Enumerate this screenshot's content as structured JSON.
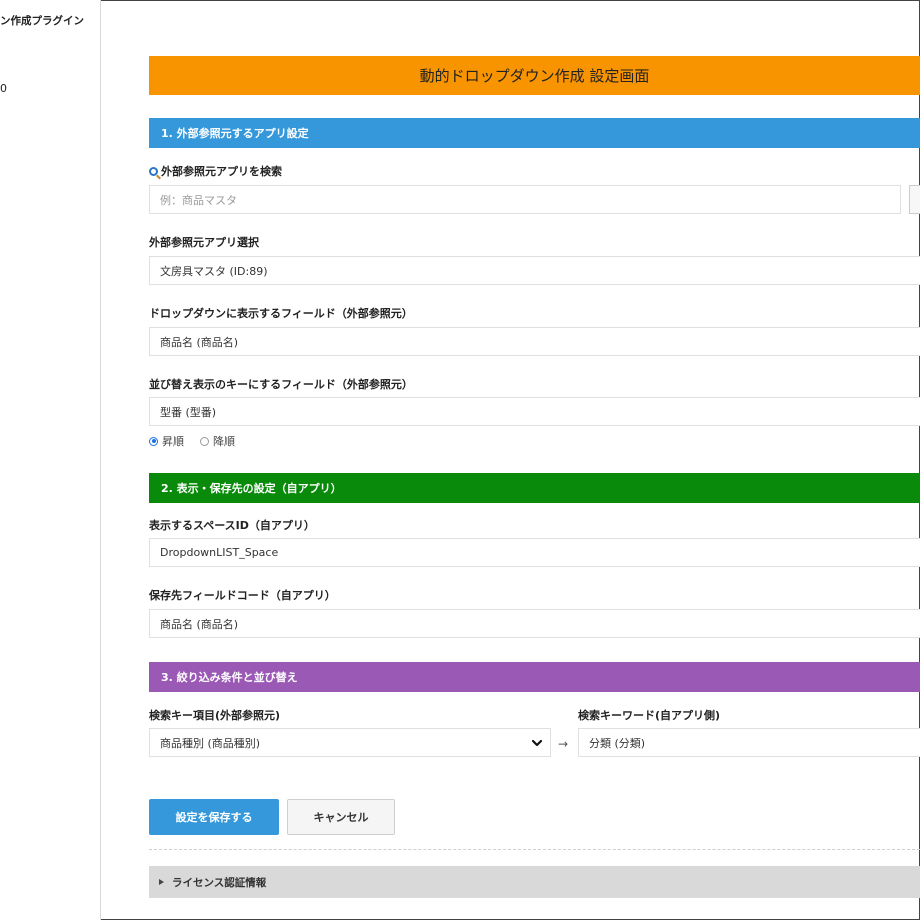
{
  "sidebar": {
    "title": "ン作成プラグイン",
    "value": "0"
  },
  "page_title": "動的ドロップダウン作成 設定画面",
  "section1": {
    "header": "1. 外部参照元するアプリ設定",
    "search_label": "外部参照元アプリを検索",
    "search_placeholder": "例：商品マスタ",
    "app_select_label": "外部参照元アプリ選択",
    "app_select_value": "文房具マスタ (ID:89)",
    "display_field_label": "ドロップダウンに表示するフィールド（外部参照元）",
    "display_field_value": "商品名 (商品名)",
    "sort_field_label": "並び替え表示のキーにするフィールド（外部参照元）",
    "sort_field_value": "型番 (型番)",
    "sort_asc": "昇順",
    "sort_desc": "降順"
  },
  "section2": {
    "header": "2. 表示・保存先の設定（自アプリ）",
    "space_label": "表示するスペースID（自アプリ）",
    "space_value": "DropdownLIST_Space",
    "save_field_label": "保存先フィールドコード（自アプリ）",
    "save_field_value": "商品名 (商品名)"
  },
  "section3": {
    "header": "3. 絞り込み条件と並び替え",
    "key_label": "検索キー項目(外部参照元)",
    "key_value": "商品種別 (商品種別)",
    "keyword_label": "検索キーワード(自アプリ側)",
    "keyword_value": "分類 (分類)",
    "arrow": "→"
  },
  "buttons": {
    "save": "設定を保存する",
    "cancel": "キャンセル"
  },
  "license": "ライセンス認証情報",
  "colors": {
    "title_bar": "#f89400",
    "section1": "#3498db",
    "section2": "#0a8a0a",
    "section3": "#9b59b6",
    "save_button": "#3498db"
  },
  "icons": {
    "search": "search-icon",
    "chevron": "chevron-down-icon",
    "disclosure": "triangle-right-icon"
  }
}
